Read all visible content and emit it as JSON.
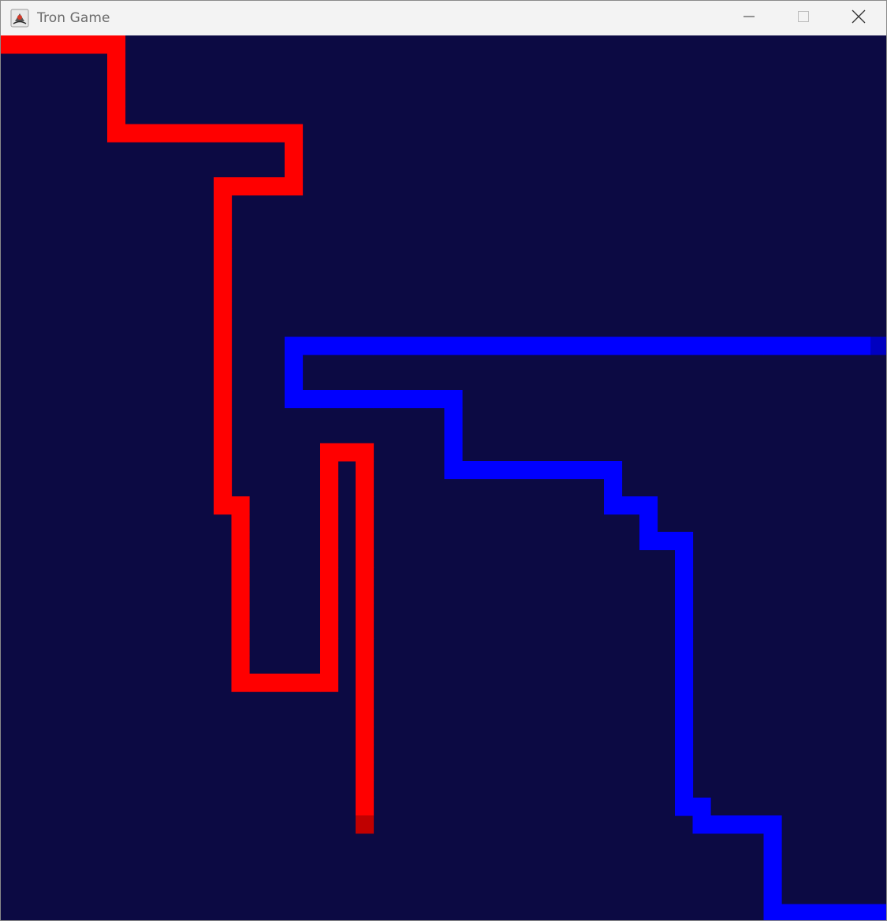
{
  "window": {
    "title": "Tron Game",
    "icon": "java-app-icon",
    "controls": [
      "minimize-icon",
      "maximize-icon",
      "close-icon"
    ]
  },
  "game": {
    "background_color": "#0c0a43",
    "players": [
      {
        "color": "#ff0000",
        "head_color": "#c00000",
        "trail_cells": [
          [
            0,
            0
          ],
          [
            1,
            0
          ],
          [
            2,
            0
          ],
          [
            3,
            0
          ],
          [
            4,
            0
          ],
          [
            5,
            0
          ],
          [
            6,
            0
          ],
          [
            6,
            1
          ],
          [
            6,
            2
          ],
          [
            6,
            3
          ],
          [
            6,
            4
          ],
          [
            6,
            5
          ],
          [
            7,
            5
          ],
          [
            8,
            5
          ],
          [
            9,
            5
          ],
          [
            10,
            5
          ],
          [
            11,
            5
          ],
          [
            12,
            5
          ],
          [
            13,
            5
          ],
          [
            14,
            5
          ],
          [
            15,
            5
          ],
          [
            16,
            5
          ],
          [
            16,
            6
          ],
          [
            16,
            7
          ],
          [
            16,
            8
          ],
          [
            15,
            8
          ],
          [
            14,
            8
          ],
          [
            13,
            8
          ],
          [
            12,
            8
          ],
          [
            12,
            9
          ],
          [
            12,
            10
          ],
          [
            12,
            11
          ],
          [
            12,
            12
          ],
          [
            12,
            13
          ],
          [
            12,
            14
          ],
          [
            12,
            15
          ],
          [
            12,
            16
          ],
          [
            12,
            17
          ],
          [
            12,
            18
          ],
          [
            12,
            19
          ],
          [
            12,
            20
          ],
          [
            12,
            21
          ],
          [
            12,
            22
          ],
          [
            12,
            23
          ],
          [
            12,
            24
          ],
          [
            12,
            25
          ],
          [
            12,
            26
          ],
          [
            13,
            26
          ],
          [
            13,
            27
          ],
          [
            13,
            28
          ],
          [
            13,
            29
          ],
          [
            13,
            30
          ],
          [
            13,
            31
          ],
          [
            13,
            32
          ],
          [
            13,
            33
          ],
          [
            13,
            34
          ],
          [
            13,
            35
          ],
          [
            13,
            36
          ],
          [
            14,
            36
          ],
          [
            15,
            36
          ],
          [
            16,
            36
          ],
          [
            17,
            36
          ],
          [
            18,
            36
          ],
          [
            18,
            35
          ],
          [
            18,
            34
          ],
          [
            18,
            33
          ],
          [
            18,
            32
          ],
          [
            18,
            31
          ],
          [
            18,
            30
          ],
          [
            18,
            29
          ],
          [
            18,
            28
          ],
          [
            18,
            27
          ],
          [
            18,
            26
          ],
          [
            18,
            25
          ],
          [
            18,
            24
          ],
          [
            18,
            23
          ],
          [
            19,
            23
          ],
          [
            20,
            23
          ],
          [
            20,
            24
          ],
          [
            20,
            25
          ],
          [
            20,
            26
          ],
          [
            20,
            27
          ],
          [
            20,
            28
          ],
          [
            20,
            29
          ],
          [
            20,
            30
          ],
          [
            20,
            31
          ],
          [
            20,
            32
          ],
          [
            20,
            33
          ],
          [
            20,
            34
          ],
          [
            20,
            35
          ],
          [
            20,
            36
          ],
          [
            20,
            37
          ],
          [
            20,
            38
          ],
          [
            20,
            39
          ],
          [
            20,
            40
          ],
          [
            20,
            41
          ],
          [
            20,
            42
          ],
          [
            20,
            43
          ],
          [
            20,
            44
          ]
        ],
        "head": [
          20,
          44
        ]
      },
      {
        "color": "#0000ff",
        "head_color": "#0000c0",
        "trail_cells": [
          [
            49,
            17
          ],
          [
            48,
            17
          ],
          [
            47,
            17
          ],
          [
            46,
            17
          ],
          [
            45,
            17
          ],
          [
            44,
            17
          ],
          [
            43,
            17
          ],
          [
            42,
            17
          ],
          [
            41,
            17
          ],
          [
            40,
            17
          ],
          [
            39,
            17
          ],
          [
            38,
            17
          ],
          [
            37,
            17
          ],
          [
            36,
            17
          ],
          [
            35,
            17
          ],
          [
            34,
            17
          ],
          [
            33,
            17
          ],
          [
            32,
            17
          ],
          [
            31,
            17
          ],
          [
            30,
            17
          ],
          [
            29,
            17
          ],
          [
            28,
            17
          ],
          [
            27,
            17
          ],
          [
            26,
            17
          ],
          [
            25,
            17
          ],
          [
            24,
            17
          ],
          [
            23,
            17
          ],
          [
            22,
            17
          ],
          [
            21,
            17
          ],
          [
            20,
            17
          ],
          [
            19,
            17
          ],
          [
            18,
            17
          ],
          [
            17,
            17
          ],
          [
            16,
            17
          ],
          [
            16,
            18
          ],
          [
            16,
            19
          ],
          [
            16,
            20
          ],
          [
            17,
            20
          ],
          [
            18,
            20
          ],
          [
            19,
            20
          ],
          [
            20,
            20
          ],
          [
            21,
            20
          ],
          [
            22,
            20
          ],
          [
            23,
            20
          ],
          [
            24,
            20
          ],
          [
            25,
            20
          ],
          [
            25,
            21
          ],
          [
            25,
            22
          ],
          [
            25,
            23
          ],
          [
            25,
            24
          ],
          [
            26,
            24
          ],
          [
            27,
            24
          ],
          [
            28,
            24
          ],
          [
            29,
            24
          ],
          [
            30,
            24
          ],
          [
            31,
            24
          ],
          [
            32,
            24
          ],
          [
            33,
            24
          ],
          [
            34,
            24
          ],
          [
            34,
            25
          ],
          [
            34,
            26
          ],
          [
            35,
            26
          ],
          [
            36,
            26
          ],
          [
            36,
            27
          ],
          [
            36,
            28
          ],
          [
            37,
            28
          ],
          [
            38,
            28
          ],
          [
            38,
            29
          ],
          [
            38,
            30
          ],
          [
            38,
            31
          ],
          [
            38,
            32
          ],
          [
            38,
            33
          ],
          [
            38,
            34
          ],
          [
            38,
            35
          ],
          [
            38,
            36
          ],
          [
            38,
            37
          ],
          [
            38,
            38
          ],
          [
            38,
            39
          ],
          [
            38,
            40
          ],
          [
            38,
            41
          ],
          [
            38,
            42
          ],
          [
            38,
            43
          ],
          [
            39,
            43
          ],
          [
            39,
            44
          ],
          [
            40,
            44
          ],
          [
            41,
            44
          ],
          [
            42,
            44
          ],
          [
            43,
            44
          ],
          [
            43,
            45
          ],
          [
            43,
            46
          ],
          [
            43,
            47
          ],
          [
            43,
            48
          ],
          [
            43,
            49
          ],
          [
            44,
            49
          ],
          [
            45,
            49
          ],
          [
            46,
            49
          ],
          [
            47,
            49
          ],
          [
            48,
            49
          ],
          [
            49,
            49
          ]
        ],
        "head": [
          49,
          17
        ]
      }
    ]
  }
}
